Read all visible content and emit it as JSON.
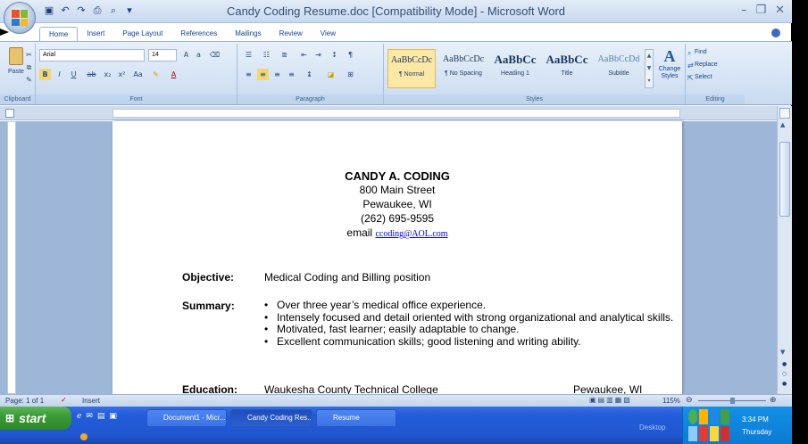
{
  "window": {
    "title": "Candy Coding Resume.doc [Compatibility Mode] - Microsoft Word",
    "min": "–",
    "max": "❐",
    "close": "✕"
  },
  "tabs": [
    "Home",
    "Insert",
    "Page Layout",
    "References",
    "Mailings",
    "Review",
    "View"
  ],
  "ribbon": {
    "clipboard": {
      "label": "Clipboard",
      "paste": "Paste"
    },
    "font": {
      "label": "Font",
      "name": "Arial",
      "size": "14"
    },
    "paragraph": {
      "label": "Paragraph"
    },
    "styles": {
      "label": "Styles",
      "items": [
        {
          "sample": "AaBbCcDc",
          "name": "¶ Normal"
        },
        {
          "sample": "AaBbCcDc",
          "name": "¶ No Spacing"
        },
        {
          "sample": "AaBbCc",
          "name": "Heading 1"
        },
        {
          "sample": "AaBbCc",
          "name": "Title"
        },
        {
          "sample": "AaBbCcDd",
          "name": "Subtitle"
        }
      ],
      "change": "Change Styles"
    },
    "editing": {
      "label": "Editing",
      "find": "Find",
      "replace": "Replace",
      "select": "Select"
    }
  },
  "document": {
    "name": "CANDY A. CODING",
    "street": "800 Main Street",
    "city": "Pewaukee, WI",
    "phone": "(262) 695-9595",
    "email_label": "email",
    "email": "ccoding@AOL.com",
    "objective_label": "Objective:",
    "objective": "Medical Coding and Billing position",
    "summary_label": "Summary:",
    "summary": [
      "Over three year’s medical office experience.",
      "Intensely focused and detail oriented with strong organizational and analytical skills.",
      "Motivated, fast learner; easily adaptable to change.",
      "Excellent communication skills; good listening and writing ability."
    ],
    "education_label": "Education:",
    "education_school": "Waukesha County Technical College",
    "education_city": "Pewaukee, WI"
  },
  "status": {
    "page": "Page: 1 of 1",
    "mode": "Insert",
    "zoom": "115%"
  },
  "taskbar": {
    "start": "start",
    "buttons": [
      "Document1 - Micr...",
      "Candy Coding Res...",
      "Resume"
    ],
    "desktop": "Desktop",
    "time": "3:34 PM",
    "day": "Thursday"
  }
}
